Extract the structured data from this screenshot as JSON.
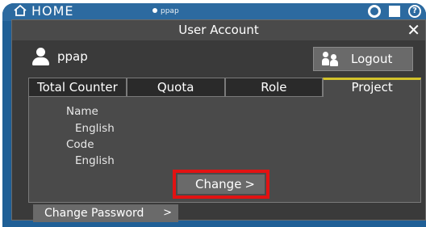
{
  "topbar": {
    "home_label": "HOME",
    "user_label": "ppap",
    "icons": [
      "home-icon",
      "user-icon",
      "gear-icon",
      "square-icon",
      "help-icon"
    ]
  },
  "dialog": {
    "title": "User Account",
    "close_icon": "close-icon",
    "user": {
      "name": "ppap",
      "icon": "person-icon"
    },
    "logout_label": "Logout",
    "tabs": [
      {
        "label": "Total Counter",
        "active": false
      },
      {
        "label": "Quota",
        "active": false
      },
      {
        "label": "Role",
        "active": false
      },
      {
        "label": "Project",
        "active": true
      }
    ],
    "project": {
      "name_label": "Name",
      "name_value": "English",
      "code_label": "Code",
      "code_value": "English",
      "change_label": "Change",
      "change_chevron": ">"
    },
    "change_password_label": "Change Password",
    "change_password_chevron": ">"
  },
  "colors": {
    "frame_blue": "#1f5f96",
    "dialog_bg": "#3a3a3a",
    "active_tab_accent": "#d2c22b",
    "highlight_red": "#e31212"
  }
}
